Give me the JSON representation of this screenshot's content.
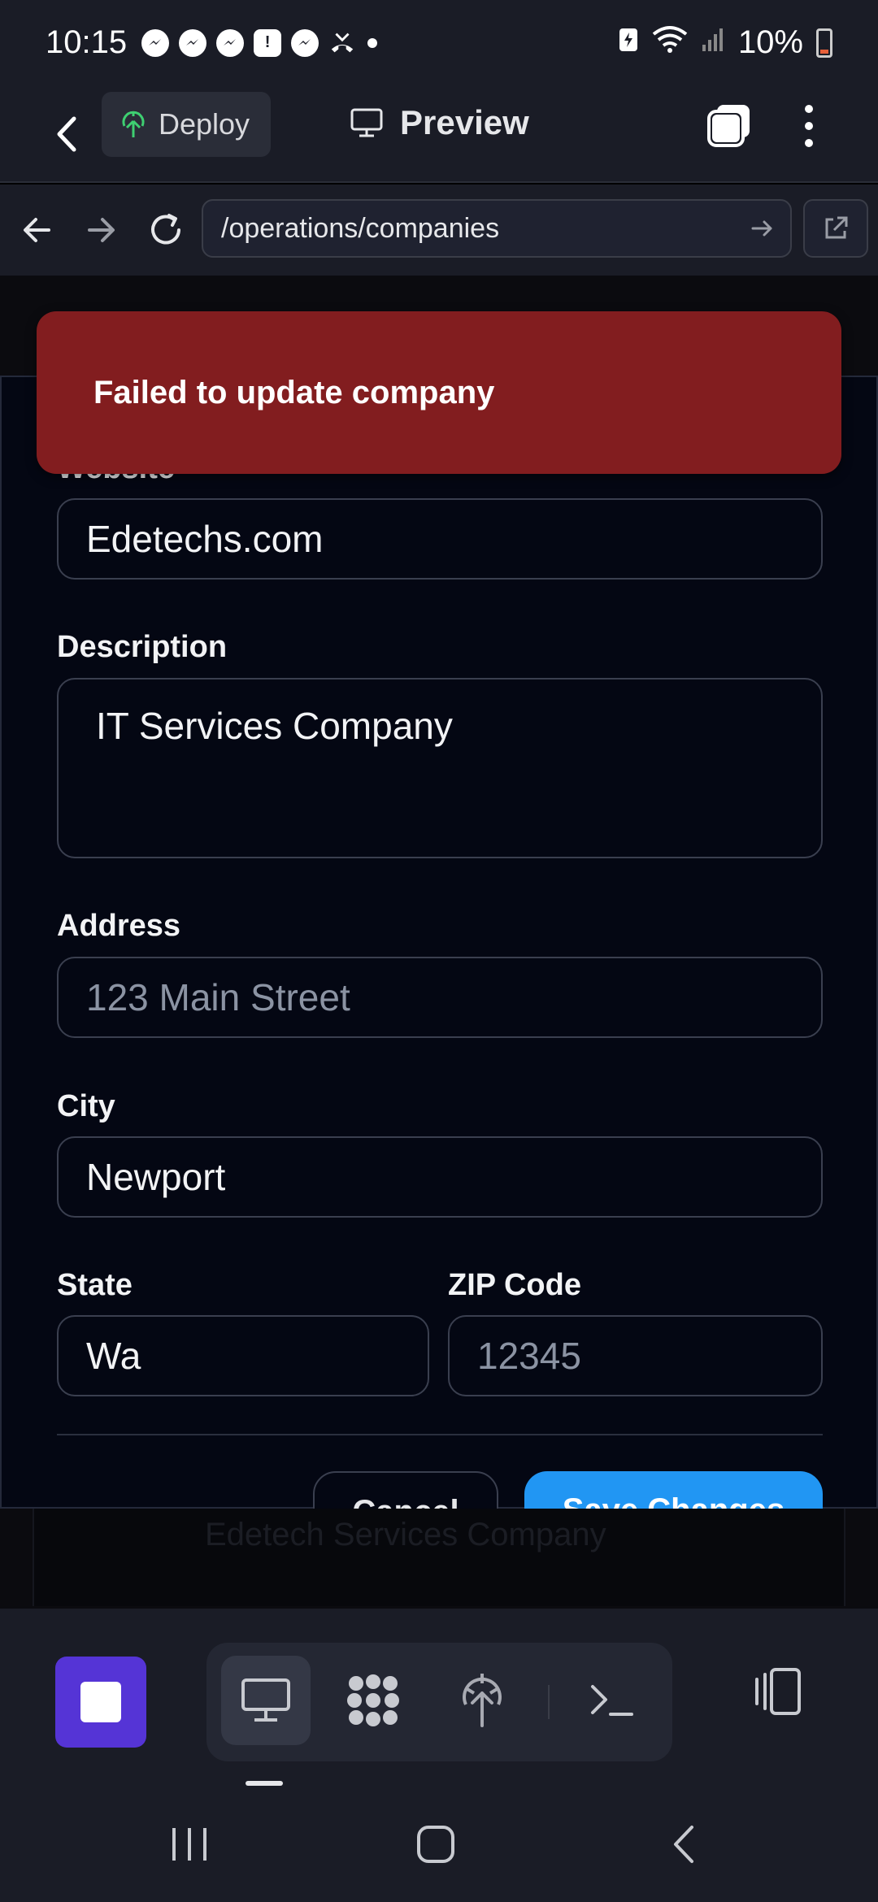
{
  "status_bar": {
    "time": "10:15",
    "battery_text": "10%",
    "notification_icons": [
      "messenger-icon",
      "messenger-icon",
      "messenger-icon",
      "alert-icon",
      "messenger-icon",
      "missed-call-icon",
      "dot-icon"
    ],
    "status_icons": [
      "battery-saver-icon",
      "wifi-icon",
      "signal-icon",
      "battery-icon"
    ]
  },
  "app_bar": {
    "deploy_label": "Deploy",
    "preview_label": "Preview"
  },
  "url_bar": {
    "url": "/operations/companies"
  },
  "toast": {
    "message": "Failed to update company",
    "color": "#821d1f"
  },
  "form": {
    "website_label_partial": "Website",
    "website_value": "Edetechs.com",
    "description_label": "Description",
    "description_value": "IT Services Company",
    "address_label": "Address",
    "address_placeholder": "123 Main Street",
    "city_label": "City",
    "city_value": "Newport",
    "state_label": "State",
    "state_value": "Wa",
    "zip_label": "ZIP Code",
    "zip_placeholder": "12345",
    "cancel_label": "Cancel",
    "save_label": "Save Changes",
    "save_color": "#2196f3"
  },
  "background_page": {
    "partial_text": "Edetech Services Company"
  },
  "toolbar": {
    "accent": "#5534d6",
    "items": [
      "desktop-icon",
      "apps-icon",
      "deploy-icon",
      "terminal-icon"
    ],
    "active_item": "desktop-icon"
  }
}
